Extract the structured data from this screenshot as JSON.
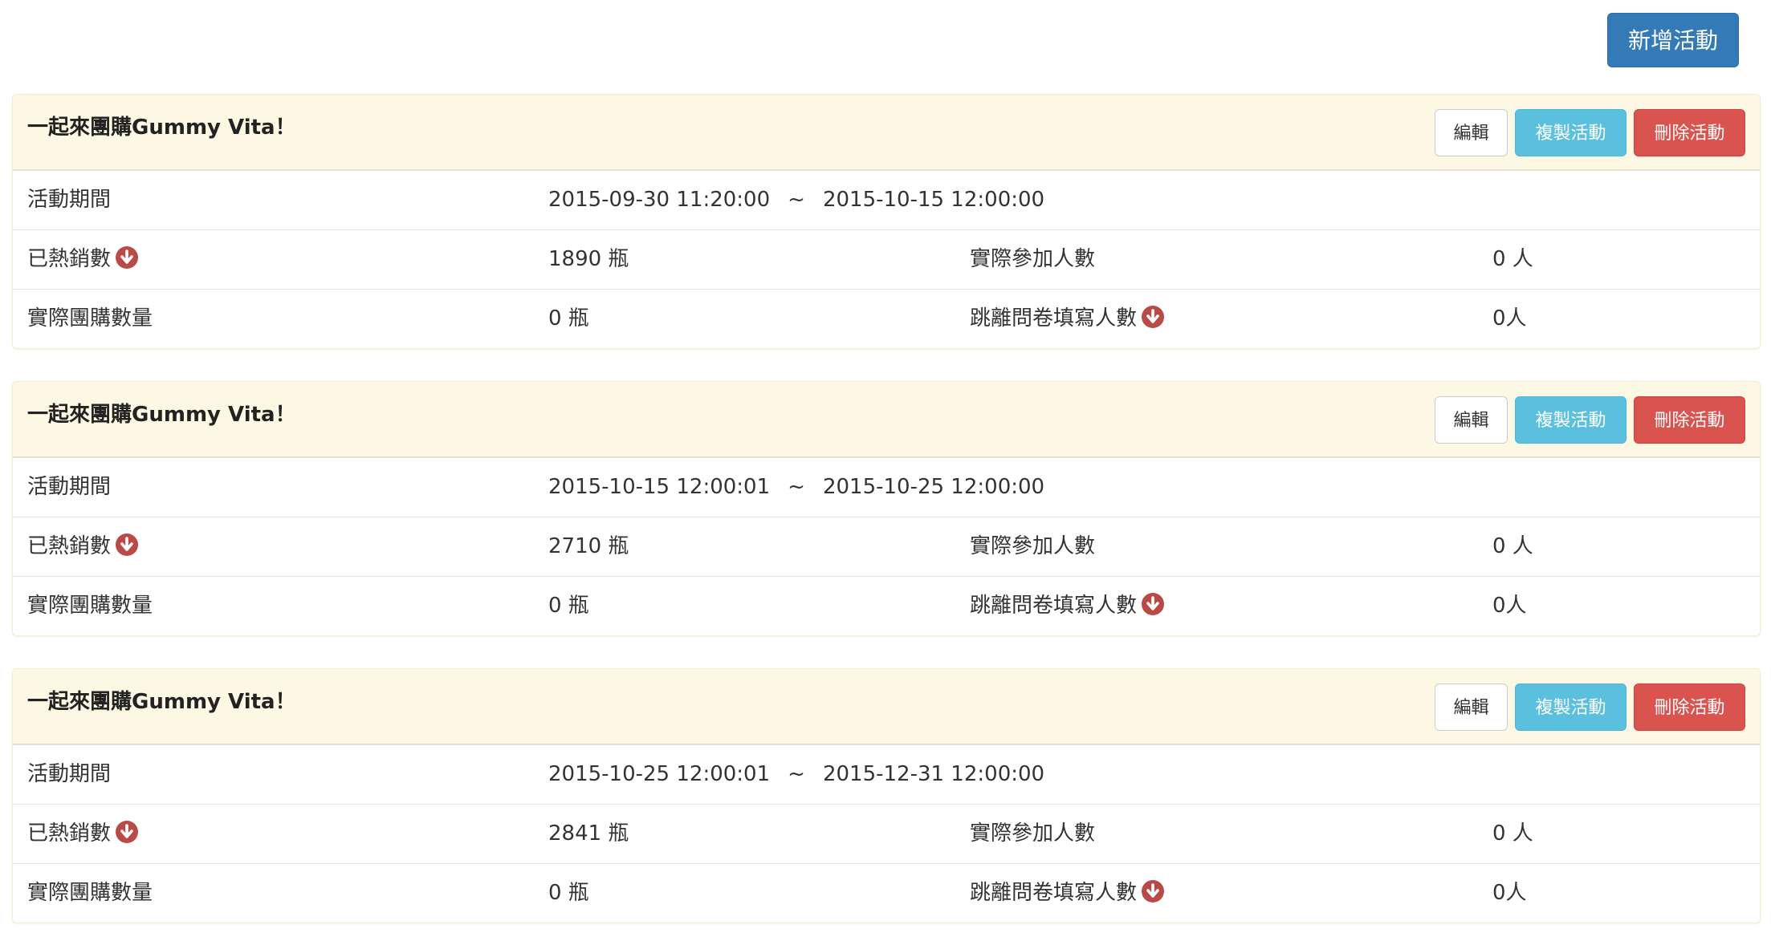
{
  "toolbar": {
    "add_label": "新增活動"
  },
  "labels": {
    "period": "活動期間",
    "sold": "已熱銷數",
    "participants": "實際參加人數",
    "group_qty": "實際團購數量",
    "left_survey": "跳離問卷填寫人數",
    "separator": "~"
  },
  "buttons": {
    "edit": "編輯",
    "copy": "複製活動",
    "delete": "刪除活動"
  },
  "icons": {
    "download": "download-circle-icon"
  },
  "colors": {
    "primary": "#337ab7",
    "info": "#5bc0de",
    "danger": "#d9534f",
    "panel_heading": "#fcf8e3",
    "icon": "#b94a48"
  },
  "panels": [
    {
      "title": "一起來團購Gummy Vita！",
      "start": "2015-09-30 11:20:00",
      "end": "2015-10-15 12:00:00",
      "sold": "1890 瓶",
      "participants": "0 人",
      "group_qty": "0 瓶",
      "left_survey": "0人"
    },
    {
      "title": "一起來團購Gummy Vita！",
      "start": "2015-10-15 12:00:01",
      "end": "2015-10-25 12:00:00",
      "sold": "2710 瓶",
      "participants": "0 人",
      "group_qty": "0 瓶",
      "left_survey": "0人"
    },
    {
      "title": "一起來團購Gummy Vita！",
      "start": "2015-10-25 12:00:01",
      "end": "2015-12-31 12:00:00",
      "sold": "2841 瓶",
      "participants": "0 人",
      "group_qty": "0 瓶",
      "left_survey": "0人"
    }
  ]
}
